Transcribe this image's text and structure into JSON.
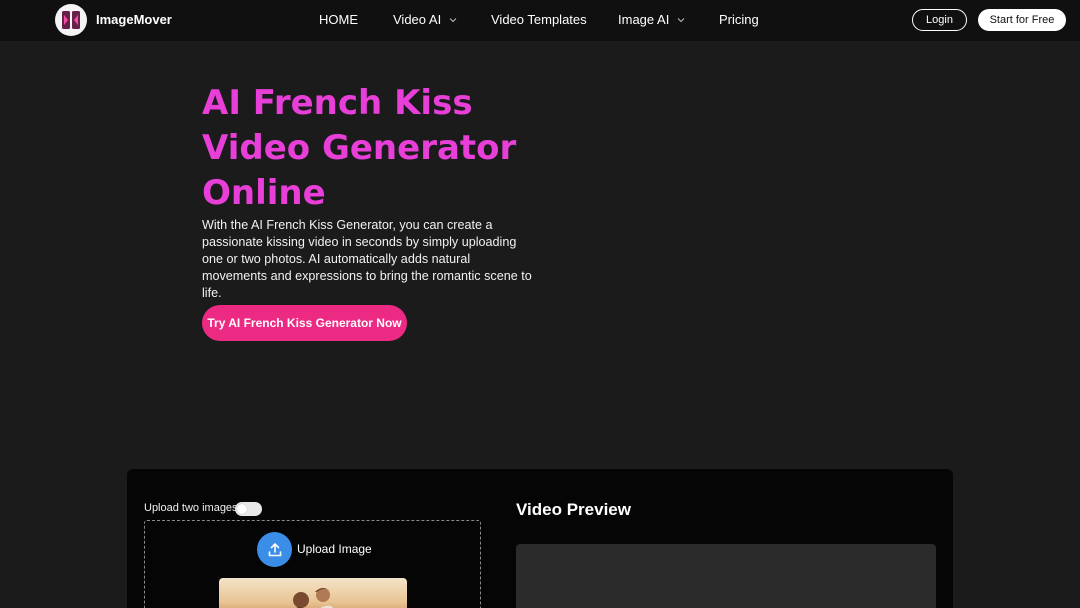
{
  "nav": {
    "brand": "ImageMover",
    "items": [
      {
        "label": "HOME"
      },
      {
        "label": "Video AI"
      },
      {
        "label": "Video Templates"
      },
      {
        "label": "Image AI"
      },
      {
        "label": "Pricing"
      }
    ],
    "login_label": "Login",
    "start_label": "Start for Free"
  },
  "hero": {
    "title": "AI French Kiss Video Generator Online",
    "description": "With the AI French Kiss Generator, you can create a passionate kissing video in seconds by simply uploading one or two photos. AI automatically adds natural movements and expressions to bring the romantic scene to life.",
    "cta_label": "Try AI French Kiss Generator Now"
  },
  "tool": {
    "toggle_label": "Upload two images",
    "upload_label": "Upload Image",
    "preview_title": "Video Preview"
  },
  "colors": {
    "accent_title": "#e83fd9",
    "cta": "#ec2a83",
    "upload_button": "#3b8ee8"
  }
}
